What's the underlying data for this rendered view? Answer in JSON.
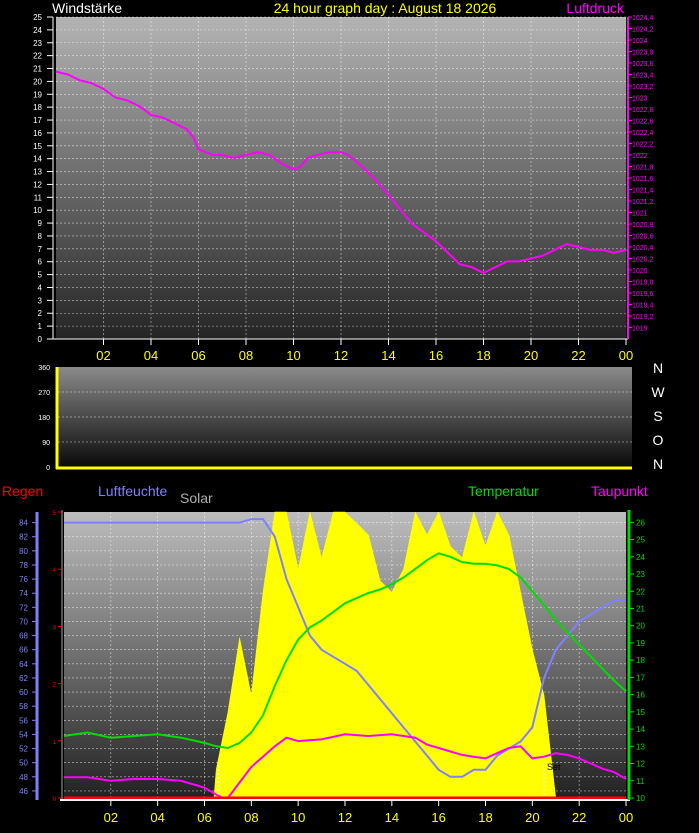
{
  "header": {
    "left_label": "Windstärke",
    "title": "24 hour graph day : August 18 2026",
    "right_label": "Luftdruck"
  },
  "colors": {
    "background": "#000000",
    "pressure": "#ff00ff",
    "axis_yellow": "#ffff00",
    "humidity": "#8080ff",
    "temperature": "#00dd00",
    "dewpoint": "#ff00ff",
    "rain": "#ff0000",
    "solar": "#ffff00",
    "solar_label": "#b0b0b0"
  },
  "x_ticks": [
    "02",
    "04",
    "06",
    "08",
    "10",
    "12",
    "14",
    "16",
    "18",
    "20",
    "22",
    "00"
  ],
  "compass_labels": [
    "N",
    "W",
    "S",
    "O",
    "N"
  ],
  "bottom_labels": {
    "rain": "Regen",
    "humidity": "Luftfeuchte",
    "solar": "Solar",
    "temperature": "Temperatur",
    "dewpoint": "Taupunkt",
    "sunset": "Set"
  },
  "chart_data": [
    {
      "type": "line",
      "name": "pressure-chart",
      "y_left_ticks": [
        "0",
        "1",
        "2",
        "3",
        "4",
        "5",
        "6",
        "7",
        "8",
        "9",
        "10",
        "11",
        "12",
        "13",
        "14",
        "15",
        "16",
        "17",
        "18",
        "19",
        "20",
        "21",
        "22",
        "23",
        "24",
        "25"
      ],
      "y_right_ticks": [
        "1019",
        "1019,2",
        "1019,4",
        "1019,6",
        "1019,8",
        "1020",
        "1020,2",
        "1020,4",
        "1020,6",
        "1020,8",
        "1021",
        "1021,2",
        "1021,4",
        "1021,6",
        "1021,8",
        "1022",
        "1022,2",
        "1022,4",
        "1022,6",
        "1022,8",
        "1023",
        "1023,2",
        "1023,4",
        "1023,6",
        "1023,8",
        "1024",
        "1024,2",
        "1024,4"
      ],
      "y_left_range": [
        0,
        25
      ],
      "y_right_range": [
        1018.8,
        1024.4
      ],
      "x_range_hours": [
        0,
        24
      ],
      "grid": true,
      "series": [
        {
          "unit": "hPa",
          "x": [
            0.0,
            0.5,
            1.0,
            1.5,
            2.0,
            2.5,
            3.0,
            3.5,
            4.0,
            4.5,
            5.0,
            5.5,
            5.8,
            6.0,
            6.3,
            6.6,
            7.0,
            7.5,
            8.0,
            8.5,
            9.0,
            9.5,
            10.0,
            10.3,
            10.6,
            11.0,
            11.5,
            12.0,
            12.3,
            12.6,
            13.0,
            13.5,
            14.0,
            14.5,
            15.0,
            15.5,
            16.0,
            16.5,
            17.0,
            17.5,
            18.0,
            18.5,
            19.0,
            19.5,
            20.0,
            20.5,
            21.0,
            21.5,
            22.0,
            22.5,
            23.0,
            23.5,
            24.0
          ],
          "y": [
            1023.45,
            1023.4,
            1023.3,
            1023.25,
            1023.15,
            1023.0,
            1022.95,
            1022.85,
            1022.7,
            1022.65,
            1022.55,
            1022.45,
            1022.3,
            1022.1,
            1022.05,
            1022.0,
            1022.0,
            1021.95,
            1022.0,
            1022.05,
            1022.0,
            1021.85,
            1021.75,
            1021.8,
            1021.95,
            1022.0,
            1022.05,
            1022.05,
            1022.0,
            1021.9,
            1021.75,
            1021.55,
            1021.3,
            1021.05,
            1020.8,
            1020.65,
            1020.5,
            1020.3,
            1020.1,
            1020.05,
            1019.95,
            1020.05,
            1020.15,
            1020.15,
            1020.2,
            1020.25,
            1020.35,
            1020.45,
            1020.4,
            1020.35,
            1020.35,
            1020.3,
            1020.35
          ]
        }
      ]
    },
    {
      "type": "line",
      "name": "wind-direction-chart",
      "y_ticks": [
        "0",
        "90",
        "180",
        "270",
        "360"
      ],
      "y_range": [
        0,
        360
      ],
      "grid": true,
      "series": []
    },
    {
      "type": "line",
      "name": "weather-chart",
      "y_humidity_ticks": [
        "46",
        "48",
        "50",
        "52",
        "54",
        "56",
        "58",
        "60",
        "62",
        "64",
        "66",
        "68",
        "70",
        "72",
        "74",
        "76",
        "78",
        "80",
        "82",
        "84"
      ],
      "y_humidity_range": [
        45,
        85.5
      ],
      "y_temperature_ticks": [
        "10",
        "11",
        "12",
        "13",
        "14",
        "15",
        "16",
        "17",
        "18",
        "19",
        "20",
        "21",
        "22",
        "23",
        "24",
        "25",
        "26"
      ],
      "y_temperature_range": [
        10,
        26.6
      ],
      "y_rain_ticks": [
        "0",
        "1",
        "2",
        "3",
        "4",
        "5"
      ],
      "y_rain_range": [
        0,
        5
      ],
      "x_range_hours": [
        0,
        24
      ],
      "grid": true,
      "sunset_hour": 20.5,
      "sunrise_hour": 6.6,
      "series": [
        {
          "name": "Luftfeuchte",
          "x": [
            0,
            2,
            4,
            6,
            7,
            7.5,
            8,
            8.5,
            9.0,
            9.5,
            10.0,
            10.5,
            11.0,
            11.5,
            12.0,
            12.5,
            13.0,
            13.5,
            14.0,
            14.5,
            15.0,
            15.5,
            16.0,
            16.5,
            17.0,
            17.5,
            18.0,
            18.5,
            19.0,
            19.5,
            20.0,
            20.5,
            21.0,
            21.5,
            22.0,
            22.5,
            23.0,
            23.5,
            24.0
          ],
          "y": [
            84,
            84,
            84,
            84,
            84,
            84,
            84.5,
            84.5,
            82,
            76,
            72,
            68,
            66,
            65,
            64,
            63,
            61,
            59,
            57,
            55,
            53,
            51,
            49,
            48,
            48,
            49,
            49,
            51,
            52,
            53,
            55,
            62,
            66,
            68,
            70,
            71,
            72,
            73,
            73
          ]
        },
        {
          "name": "Temperatur",
          "x": [
            0,
            1,
            2,
            3,
            4,
            5,
            6,
            6.5,
            7,
            7.5,
            8.0,
            8.5,
            9.0,
            9.5,
            10.0,
            10.5,
            11.0,
            11.5,
            12.0,
            12.5,
            13.0,
            13.5,
            14.0,
            14.5,
            15.0,
            15.5,
            16.0,
            16.5,
            17.0,
            17.5,
            18.0,
            18.5,
            19.0,
            19.5,
            20.0,
            20.5,
            21.0,
            21.5,
            22.0,
            22.5,
            23.0,
            23.5,
            24.0
          ],
          "y": [
            13.6,
            13.8,
            13.5,
            13.6,
            13.7,
            13.5,
            13.2,
            13.0,
            12.9,
            13.2,
            13.8,
            14.8,
            16.5,
            18.0,
            19.2,
            19.9,
            20.3,
            20.8,
            21.3,
            21.6,
            21.9,
            22.1,
            22.4,
            22.8,
            23.3,
            23.8,
            24.2,
            24.0,
            23.7,
            23.6,
            23.6,
            23.5,
            23.3,
            22.8,
            22.0,
            21.2,
            20.3,
            19.6,
            18.9,
            18.2,
            17.5,
            16.8,
            16.2
          ]
        },
        {
          "name": "Taupunkt",
          "x": [
            0,
            1,
            2,
            3,
            4,
            5,
            6,
            6.5,
            6.8,
            7.0,
            7.5,
            8.0,
            8.5,
            9.0,
            9.5,
            10.0,
            11.0,
            12.0,
            13.0,
            14.0,
            14.5,
            15.0,
            15.5,
            16.0,
            16.5,
            17.0,
            17.5,
            18.0,
            18.5,
            19.0,
            19.5,
            20.0,
            20.5,
            21.0,
            21.5,
            22.0,
            22.5,
            23.0,
            23.5,
            24.0
          ],
          "y": [
            11.2,
            11.2,
            11.0,
            11.1,
            11.1,
            11.0,
            10.6,
            10.2,
            10.0,
            10.0,
            10.9,
            11.8,
            12.4,
            13.0,
            13.5,
            13.3,
            13.4,
            13.7,
            13.6,
            13.7,
            13.6,
            13.5,
            13.1,
            12.9,
            12.7,
            12.5,
            12.4,
            12.3,
            12.6,
            12.9,
            13.0,
            12.3,
            12.4,
            12.6,
            12.5,
            12.3,
            12.0,
            11.7,
            11.5,
            11.1
          ]
        },
        {
          "name": "Solar",
          "x": [
            0,
            6.4,
            6.5,
            7.0,
            7.5,
            8.0,
            8.5,
            9.0,
            9.5,
            10.0,
            10.5,
            11.0,
            11.5,
            12.0,
            12.5,
            13.0,
            13.5,
            14.0,
            14.5,
            15.0,
            15.5,
            16.0,
            16.5,
            17.0,
            17.5,
            18.0,
            18.5,
            19.0,
            19.5,
            20.0,
            20.5,
            21.0,
            24.0
          ],
          "y": [
            0,
            0,
            0.5,
            1.5,
            2.8,
            1.8,
            3.6,
            5.0,
            5.0,
            4.0,
            5.0,
            4.2,
            5.0,
            5.0,
            4.8,
            4.6,
            3.8,
            3.6,
            4.0,
            5.0,
            4.6,
            5.0,
            4.4,
            4.2,
            5.0,
            4.4,
            5.0,
            4.6,
            3.6,
            2.6,
            1.8,
            0,
            0
          ]
        },
        {
          "name": "Regen",
          "x": [
            0,
            24
          ],
          "y": [
            0,
            0
          ]
        }
      ]
    }
  ]
}
